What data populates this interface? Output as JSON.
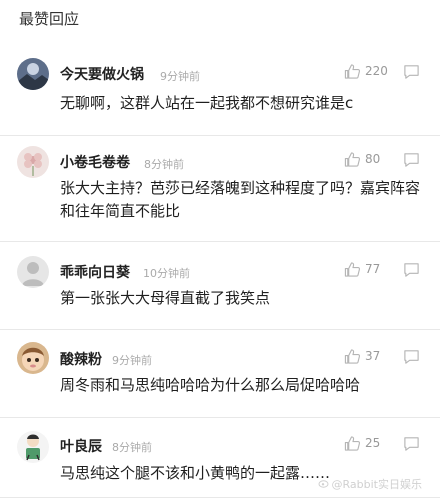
{
  "section_title": "最赞回应",
  "comments": [
    {
      "user": "今天要做火锅",
      "time": "9分钟前",
      "likes": "220",
      "text": "无聊啊，这群人站在一起我都不想研究谁是c",
      "avatar_icon": "landscape-avatar-icon"
    },
    {
      "user": "小卷毛卷卷",
      "time": "8分钟前",
      "likes": "80",
      "text": "张大大主持？芭莎已经落魄到这种程度了吗？嘉宾阵容和往年简直不能比",
      "avatar_icon": "flower-avatar-icon"
    },
    {
      "user": "乖乖向日葵",
      "time": "10分钟前",
      "likes": "77",
      "text": "第一张张大大母得直截了我笑点",
      "avatar_icon": "default-person-avatar-icon"
    },
    {
      "user": "酸辣粉",
      "time": "9分钟前",
      "likes": "37",
      "text": "周冬雨和马思纯哈哈哈为什么那么局促哈哈哈",
      "avatar_icon": "baby-avatar-icon"
    },
    {
      "user": "叶良辰",
      "time": "8分钟前",
      "likes": "25",
      "text": "马思纯这个腿不该和小黄鸭的一起露……",
      "avatar_icon": "cartoon-avatar-icon"
    }
  ],
  "watermark": "@Rabbit实日娱乐",
  "colors": {
    "text": "#1f1f1f",
    "muted": "#aaaaaa",
    "divider": "#e8e8e8"
  }
}
